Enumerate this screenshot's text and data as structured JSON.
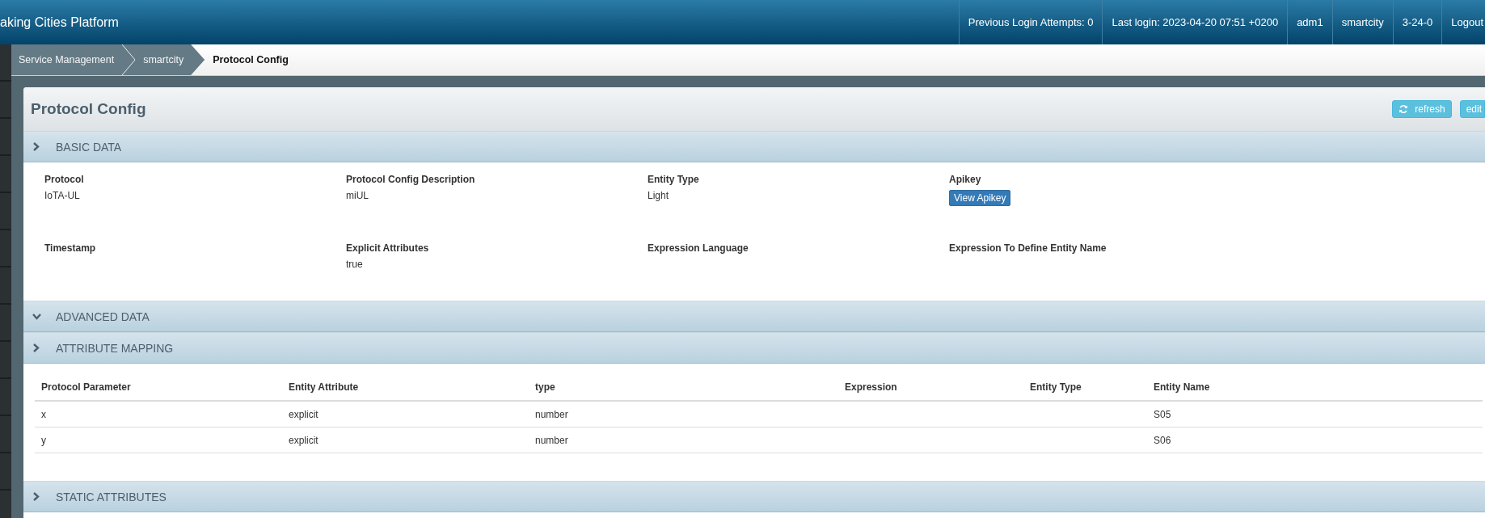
{
  "topbar": {
    "title": "aking Cities Platform",
    "items": [
      {
        "label": "Previous Login Attempts: 0"
      },
      {
        "label": "Last login: 2023-04-20 07:51 +0200"
      },
      {
        "label": "adm1"
      },
      {
        "label": "smartcity"
      },
      {
        "label": "3-24-0"
      },
      {
        "label": "Logout"
      }
    ]
  },
  "breadcrumb": [
    {
      "label": "Service Management",
      "selected": false
    },
    {
      "label": "smartcity",
      "selected": false
    },
    {
      "label": "Protocol Config",
      "selected": true
    }
  ],
  "panel": {
    "title": "Protocol Config",
    "buttons": [
      {
        "label": "refresh",
        "kind": "refresh"
      },
      {
        "label": "edit",
        "kind": "plain"
      }
    ]
  },
  "sections": [
    {
      "kind": "fields",
      "title": "BASIC DATA",
      "expanded": false,
      "fields": [
        {
          "label": "Protocol",
          "value": "IoTA-UL",
          "kind": "text"
        },
        {
          "label": "Protocol Config Description",
          "value": "miUL",
          "kind": "text"
        },
        {
          "label": "Entity Type",
          "value": "Light",
          "kind": "text"
        },
        {
          "label": "Apikey",
          "value": "View Apikey",
          "kind": "button"
        },
        {
          "label": "Timestamp",
          "kind": "text"
        },
        {
          "label": "Explicit Attributes",
          "value": "true",
          "kind": "text"
        },
        {
          "label": "Expression Language",
          "kind": "text"
        },
        {
          "label": "Expression To Define Entity Name",
          "kind": "text"
        }
      ]
    },
    {
      "kind": "empty",
      "title": "ADVANCED DATA",
      "expanded": true
    },
    {
      "kind": "table",
      "title": "ATTRIBUTE MAPPING",
      "expanded": false,
      "table": {
        "columns": [
          "Protocol Parameter",
          "Entity Attribute",
          "type",
          "Expression",
          "Entity Type",
          "Entity Name"
        ],
        "rows": [
          [
            "x",
            "explicit",
            "number",
            "",
            "",
            "S05"
          ],
          [
            "y",
            "explicit",
            "number",
            "",
            "",
            "S06"
          ]
        ]
      }
    },
    {
      "kind": "empty",
      "title": "STATIC ATTRIBUTES",
      "expanded": false
    }
  ]
}
